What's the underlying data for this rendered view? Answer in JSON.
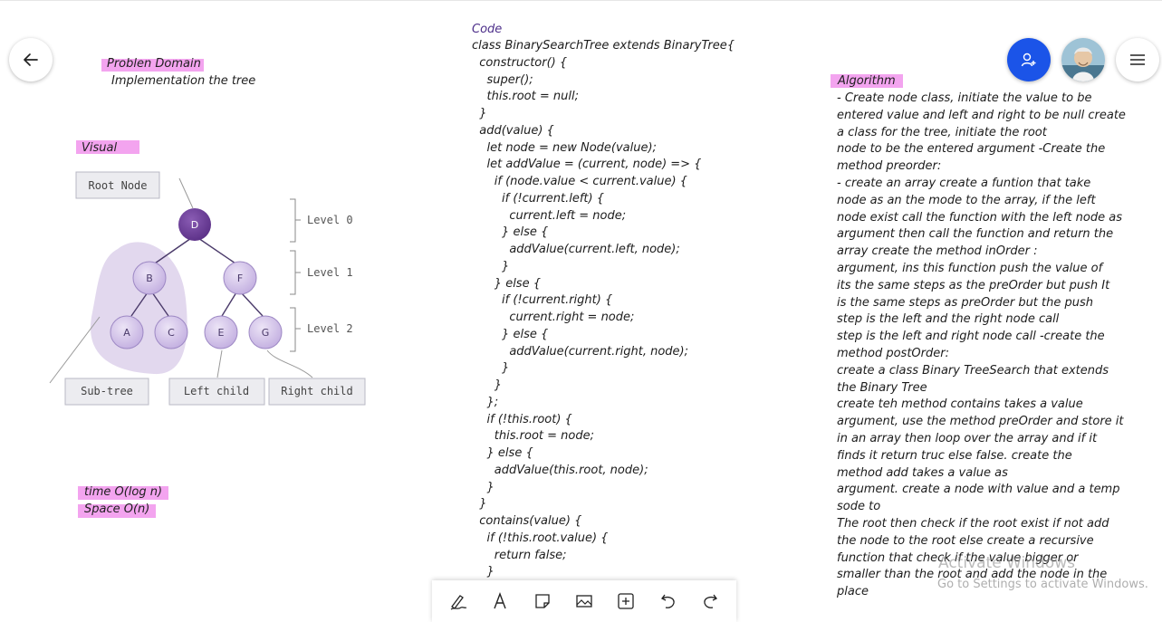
{
  "headings": {
    "problem_domain": "Problen Domain",
    "problem_text": "Implementation the tree",
    "visual": "Visual",
    "time": "time O(log n)",
    "space": "Space O(n)",
    "code": "Code",
    "algorithm": "Algorithm"
  },
  "diagram": {
    "root_label": "Root Node",
    "levels": [
      "Level 0",
      "Level 1",
      "Level 2"
    ],
    "nodes": [
      "D",
      "B",
      "F",
      "A",
      "C",
      "E",
      "G"
    ],
    "bottom_labels": [
      "Sub-tree",
      "Left child",
      "Right child"
    ]
  },
  "code_lines": [
    "class BinarySearchTree extends BinaryTree{",
    "  constructor() {",
    "    super();",
    "    this.root = null;",
    "  }",
    "  add(value) {",
    "    let node = new Node(value);",
    "    let addValue = (current, node) => {",
    "      if (node.value < current.value) {",
    "        if (!current.left) {",
    "          current.left = node;",
    "        } else {",
    "          addValue(current.left, node);",
    "        }",
    "      } else {",
    "        if (!current.right) {",
    "          current.right = node;",
    "        } else {",
    "          addValue(current.right, node);",
    "        }",
    "      }",
    "    };",
    "    if (!this.root) {",
    "      this.root = node;",
    "    } else {",
    "      addValue(this.root, node);",
    "    }",
    "  }",
    "  contains(value) {",
    "    if (!this.root.value) {",
    "      return false;",
    "    }"
  ],
  "algorithm_lines": [
    " - Create node class, initiate the value to be",
    "entered value and left and right to be null create",
    "a class for the tree, initiate the root",
    "node to be the entered argument -Create the",
    "method preorder:",
    "- create an array create a funtion that take",
    "node as an the mode to the array, if the left",
    "node exist call the function with the left node as",
    "argument then call the function and return the",
    "array create the method inOrder :",
    "argument, ins this function push the value of",
    "its the same steps as the preOrder but push It",
    "is the same steps as preOrder but the push",
    "step is the left and the right node call",
    "step is the left and right node call -create the",
    "method postOrder:",
    "create a class Binary TreeSearch that extends",
    "the Binary Tree",
    "create teh method contains takes a value",
    "argument, use the method preOrder and store it",
    "in an array then loop over the array and if it",
    "finds it return truc else false. create the",
    "method add takes a value as",
    "argument. create a node with value and a temp",
    "sode to",
    "The root then check if the root exist if not add",
    "the node to the root else create a recursive",
    "function that check if the value bigger or",
    "smaller than the root and add the node in the",
    "place"
  ],
  "watermark": {
    "line1": "Activate Windows",
    "line2": "Go to Settings to activate Windows."
  },
  "toolbar": {
    "tools": [
      "pen-icon",
      "text-icon",
      "sticky-note-icon",
      "image-icon",
      "add-icon",
      "undo-icon",
      "redo-icon"
    ]
  },
  "colors": {
    "highlight": "#f3a4ef",
    "share_button": "#1b54e8",
    "node_fill": "#cdbde6",
    "root_fill": "#6a3d94"
  }
}
